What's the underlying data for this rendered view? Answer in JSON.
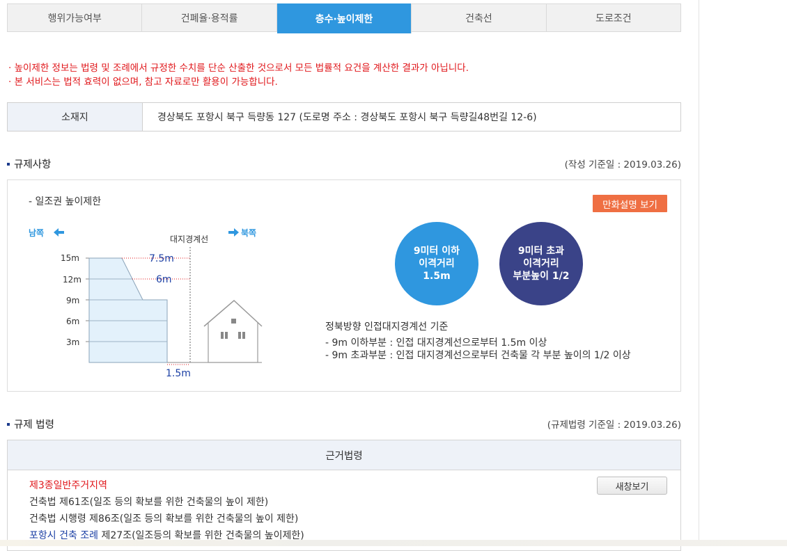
{
  "tabs": [
    {
      "label": "행위가능여부",
      "active": false
    },
    {
      "label": "건폐율·용적률",
      "active": false
    },
    {
      "label": "층수·높이제한",
      "active": true
    },
    {
      "label": "건축선",
      "active": false
    },
    {
      "label": "도로조건",
      "active": false
    }
  ],
  "notices": [
    "· 높이제한 정보는 법령 및 조례에서 규정한 수치를 단순 산출한 것으로서 모든 법률적 요건을 계산한 결과가 아닙니다.",
    "· 본 서비스는 법적 효력이 없으며, 참고 자료로만 활용이 가능합니다."
  ],
  "location": {
    "header": "소재지",
    "value": "경상북도 포항시 북구 득량동 127 (도로명 주소 : 경상북도 포항시 북구 득량길48번길 12-6)"
  },
  "regulation": {
    "title": "규제사항",
    "date": "(작성 기준일 : 2019.03.26)",
    "subhead": "- 일조권 높이제한",
    "cartoon_button": "만화설명 보기",
    "diagram": {
      "south": "남쪽",
      "north": "북쪽",
      "boundary": "대지경계선",
      "y_ticks": [
        "15m",
        "12m",
        "9m",
        "6m",
        "3m"
      ],
      "dist_top": "7.5m",
      "dist_mid": "6m",
      "dist_bottom": "1.5m"
    },
    "circle1": [
      "9미터 이하",
      "이격거리",
      "1.5m"
    ],
    "circle2": [
      "9미터 초과",
      "이격거리",
      "부분높이 1/2"
    ],
    "criteria_title": "정북방향 인접대지경계선 기준",
    "criteria": [
      "- 9m 이하부분 : 인접 대지경계선으로부터 1.5m 이상",
      "- 9m 초과부분 : 인접 대지경계선으로부터 건축물 각 부분 높이의 1/2 이상"
    ]
  },
  "laws": {
    "title": "규제 법령",
    "date": "(규제법령 기준일 : 2019.03.26)",
    "header": "근거법령",
    "zone": "제3종일반주거지역",
    "new_window": "새창보기",
    "lines": [
      "건축법 제61조(일조 등의 확보를 위한 건축물의 높이 제한)",
      "건축법 시행령 제86조(일조 등의 확보를 위한 건축물의 높이 제한)"
    ],
    "ordinance_link": "포항시 건축 조례",
    "ordinance_rest": " 제27조(일조등의 확보를 위한 건축물의 높이제한)"
  }
}
